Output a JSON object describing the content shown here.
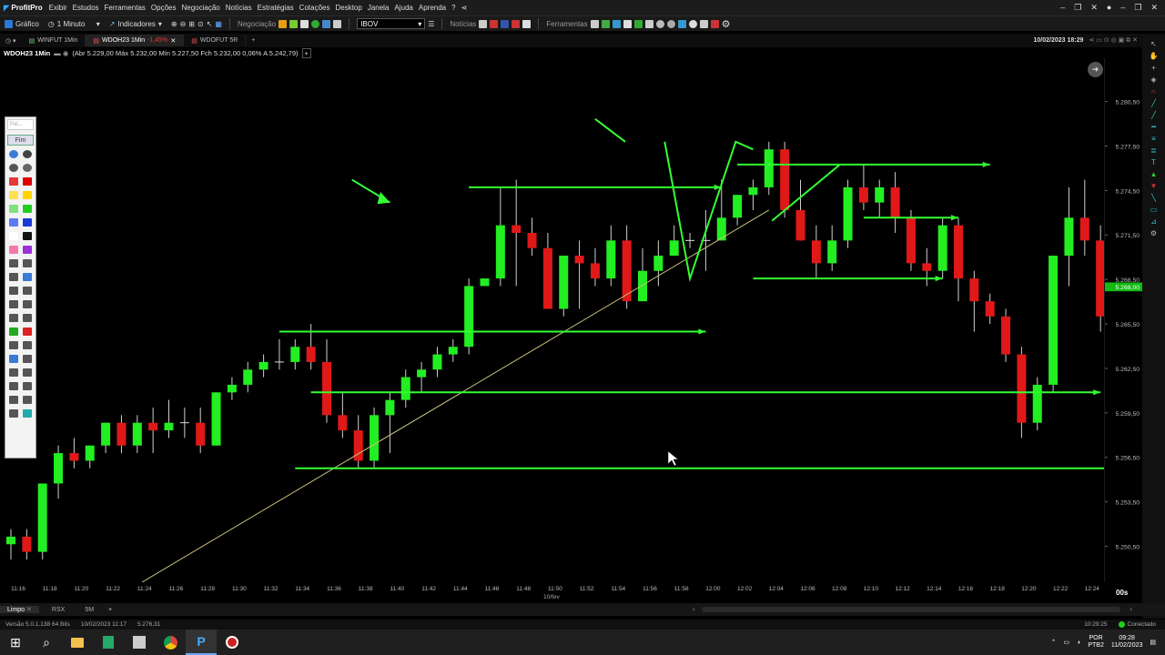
{
  "menubar": {
    "app_name": "ProfitPro",
    "items": [
      "Exibir",
      "Estudos",
      "Ferramentas",
      "Opções",
      "Negociação",
      "Notícias",
      "Estratégias",
      "Cotações",
      "Desktop",
      "Janela",
      "Ajuda",
      "Aprenda",
      "Help"
    ]
  },
  "toolbar": {
    "grafico": "Gráfico",
    "timeframe": "1 Minuto",
    "indicadores": "Indicadores",
    "negociacao": "Negociação",
    "symbol": "IBOV",
    "noticias": "Notícias",
    "ferramentas": "Ferramentas"
  },
  "tabs": [
    {
      "label": "WINFUT 1Min",
      "change": ""
    },
    {
      "label": "WDOH23 1Min",
      "change": "-1,45%"
    },
    {
      "label": "WDOFUT 5R",
      "change": ""
    }
  ],
  "datetime": "10/02/2023 18:29",
  "info": {
    "title": "WDOH23 1Min",
    "ohlc": "(Abr 5.229,00 Máx 5.232,00 Mín 5.227,50 Fch 5.232,00 0,06% A 5.242,79)"
  },
  "draw_panel": {
    "search_placeholder": "Pal...",
    "fim_label": "Fim"
  },
  "chart_data": {
    "type": "candlestick",
    "ylim": [
      5248.5,
      5283.0
    ],
    "y_ticks": [
      "5.280,50",
      "5.277,50",
      "5.274,50",
      "5.271,50",
      "5.268,50",
      "5.265,50",
      "5.262,50",
      "5.259,50",
      "5.256,50",
      "5.253,50",
      "5.250,50"
    ],
    "y_tick_values": [
      5280.5,
      5277.5,
      5274.5,
      5271.5,
      5268.5,
      5265.5,
      5262.5,
      5259.5,
      5256.5,
      5253.5,
      5250.5
    ],
    "x_ticks": [
      "11:16",
      "11:18",
      "11:20",
      "11:22",
      "11:24",
      "11:26",
      "11:28",
      "11:30",
      "11:32",
      "11:34",
      "11:36",
      "11:38",
      "11:40",
      "11:42",
      "11:44",
      "11:46",
      "11:48",
      "11:50",
      "11:52",
      "11:54",
      "11:56",
      "11:58",
      "12:00",
      "12:02",
      "12:04",
      "12:06",
      "12:08",
      "12:10",
      "12:12",
      "12:14",
      "12:16",
      "12:18",
      "12:20",
      "12:22",
      "12:24"
    ],
    "date_label": "10/fev",
    "current_price": "5.268,00",
    "time_remaining": "00s",
    "up_color": "#22ee22",
    "down_color": "#e01818",
    "candles": [
      [
        5251.0,
        5252.0,
        5250.0,
        5251.5
      ],
      [
        5251.5,
        5252.0,
        5250.0,
        5250.5
      ],
      [
        5250.5,
        5255.0,
        5250.0,
        5255.0
      ],
      [
        5255.0,
        5257.5,
        5254.0,
        5257.0
      ],
      [
        5257.0,
        5258.0,
        5256.0,
        5256.5
      ],
      [
        5256.5,
        5257.5,
        5256.0,
        5257.5
      ],
      [
        5257.5,
        5259.0,
        5257.0,
        5259.0
      ],
      [
        5259.0,
        5259.5,
        5257.0,
        5257.5
      ],
      [
        5257.5,
        5259.5,
        5257.0,
        5259.0
      ],
      [
        5259.0,
        5260.0,
        5257.0,
        5258.5
      ],
      [
        5258.5,
        5260.5,
        5258.0,
        5259.0
      ],
      [
        5259.0,
        5260.0,
        5258.0,
        5259.0
      ],
      [
        5259.0,
        5260.0,
        5257.0,
        5257.5
      ],
      [
        5257.5,
        5261.0,
        5257.5,
        5261.0
      ],
      [
        5261.0,
        5262.0,
        5260.5,
        5261.5
      ],
      [
        5261.5,
        5263.0,
        5261.0,
        5262.5
      ],
      [
        5262.5,
        5263.5,
        5262.0,
        5263.0
      ],
      [
        5263.0,
        5264.5,
        5262.5,
        5263.0
      ],
      [
        5263.0,
        5264.5,
        5262.5,
        5264.0
      ],
      [
        5264.0,
        5265.5,
        5262.5,
        5263.0
      ],
      [
        5263.0,
        5264.5,
        5259.0,
        5259.5
      ],
      [
        5259.5,
        5261.0,
        5258.0,
        5258.5
      ],
      [
        5258.5,
        5259.5,
        5256.0,
        5256.5
      ],
      [
        5256.5,
        5260.0,
        5256.0,
        5259.5
      ],
      [
        5259.5,
        5261.0,
        5257.0,
        5260.5
      ],
      [
        5260.5,
        5262.5,
        5260.0,
        5262.0
      ],
      [
        5262.0,
        5263.0,
        5261.0,
        5262.5
      ],
      [
        5262.5,
        5264.0,
        5262.0,
        5263.5
      ],
      [
        5263.5,
        5264.5,
        5263.0,
        5264.0
      ],
      [
        5264.0,
        5268.5,
        5263.5,
        5268.0
      ],
      [
        5268.0,
        5268.5,
        5268.0,
        5268.5
      ],
      [
        5268.5,
        5274.5,
        5268.0,
        5272.0
      ],
      [
        5272.0,
        5275.0,
        5268.0,
        5271.5
      ],
      [
        5271.5,
        5272.5,
        5270.0,
        5270.5
      ],
      [
        5270.5,
        5271.5,
        5266.5,
        5266.5
      ],
      [
        5266.5,
        5270.0,
        5266.0,
        5270.0
      ],
      [
        5270.0,
        5271.0,
        5266.5,
        5269.5
      ],
      [
        5269.5,
        5270.5,
        5268.0,
        5268.5
      ],
      [
        5268.5,
        5272.0,
        5268.0,
        5271.0
      ],
      [
        5271.0,
        5272.0,
        5266.5,
        5267.0
      ],
      [
        5267.0,
        5270.5,
        5267.0,
        5269.0
      ],
      [
        5269.0,
        5271.0,
        5268.0,
        5270.0
      ],
      [
        5270.0,
        5272.0,
        5270.0,
        5271.0
      ],
      [
        5271.0,
        5271.5,
        5270.5,
        5271.0
      ],
      [
        5271.0,
        5273.0,
        5269.0,
        5271.0
      ],
      [
        5271.0,
        5275.0,
        5271.0,
        5272.5
      ],
      [
        5272.5,
        5274.0,
        5272.0,
        5274.0
      ],
      [
        5274.0,
        5275.0,
        5273.0,
        5274.5
      ],
      [
        5274.5,
        5277.5,
        5274.0,
        5277.0
      ],
      [
        5277.0,
        5277.5,
        5272.5,
        5273.0
      ],
      [
        5273.0,
        5275.0,
        5271.0,
        5271.0
      ],
      [
        5271.0,
        5272.0,
        5268.5,
        5269.5
      ],
      [
        5269.5,
        5272.0,
        5269.0,
        5271.0
      ],
      [
        5271.0,
        5275.0,
        5270.5,
        5274.5
      ],
      [
        5274.5,
        5276.0,
        5273.0,
        5273.5
      ],
      [
        5273.5,
        5275.0,
        5272.5,
        5274.5
      ],
      [
        5274.5,
        5275.5,
        5271.5,
        5272.5
      ],
      [
        5272.5,
        5273.0,
        5269.0,
        5269.5
      ],
      [
        5269.5,
        5270.5,
        5268.0,
        5269.0
      ],
      [
        5269.0,
        5272.5,
        5268.5,
        5272.0
      ],
      [
        5272.0,
        5272.5,
        5267.0,
        5268.5
      ],
      [
        5268.5,
        5269.0,
        5265.0,
        5267.0
      ],
      [
        5267.0,
        5267.5,
        5265.5,
        5266.0
      ],
      [
        5266.0,
        5266.5,
        5263.0,
        5263.5
      ],
      [
        5263.5,
        5264.0,
        5258.0,
        5259.0
      ],
      [
        5259.0,
        5262.0,
        5258.5,
        5261.5
      ],
      [
        5261.5,
        5270.0,
        5261.0,
        5270.0
      ],
      [
        5270.0,
        5274.5,
        5268.0,
        5272.5
      ],
      [
        5272.5,
        5275.0,
        5270.0,
        5271.0
      ],
      [
        5271.0,
        5272.0,
        5265.0,
        5266.0
      ],
      [
        5266.0,
        5267.5,
        5264.5,
        5266.5
      ],
      [
        5266.5,
        5268.0,
        5265.0,
        5267.5
      ],
      [
        5267.5,
        5270.0,
        5267.0,
        5267.5
      ],
      [
        5267.5,
        5268.5,
        5267.0,
        5268.0
      ],
      [
        5268.0,
        5269.0,
        5267.0,
        5268.5
      ],
      [
        5268.5,
        5270.0,
        5266.5,
        5268.0
      ],
      [
        5268.0,
        5270.0,
        5267.5,
        5268.5
      ],
      [
        5268.5,
        5270.5,
        5266.5,
        5268.0
      ],
      [
        5268.0,
        5269.0,
        5266.0,
        5266.5
      ],
      [
        5266.5,
        5268.0,
        5265.0,
        5265.5
      ],
      [
        5265.5,
        5267.5,
        5264.5,
        5267.5
      ],
      [
        5267.5,
        5268.0,
        5265.0,
        5266.5
      ],
      [
        5266.5,
        5269.0,
        5265.0,
        5268.5
      ],
      [
        5268.5,
        5269.0,
        5266.0,
        5268.0
      ]
    ]
  },
  "annotations": {
    "hlines": [
      {
        "y": 5274.5,
        "t0": 29,
        "t1": 45
      },
      {
        "y": 5276.0,
        "t0": 46,
        "t1": 62
      },
      {
        "y": 5272.5,
        "t0": 54,
        "t1": 60
      },
      {
        "y": 5268.5,
        "t0": 47,
        "t1": 59
      },
      {
        "y": 5265.0,
        "t0": 17,
        "t1": 44
      },
      {
        "y": 5261.0,
        "t0": 19,
        "t1": 69
      },
      {
        "y": 5256.0,
        "t0": 18,
        "t1": 76
      }
    ]
  },
  "subbar": {
    "tabs": [
      "Limpo",
      "RSX",
      "5M"
    ]
  },
  "status": {
    "version": "Versão 5.0.1.138 64 Bits",
    "time": "10/02/2023 11:17",
    "price": "5.276,31",
    "clock": "10:29:25",
    "conn": "Conectado"
  },
  "taskbar": {
    "lang": "POR",
    "layout": "PTB2",
    "time": "09:28",
    "date": "11/02/2023"
  }
}
